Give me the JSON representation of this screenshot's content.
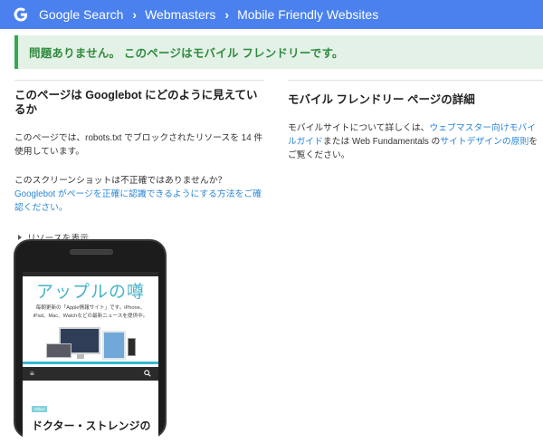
{
  "header": {
    "crumbs": [
      "Google Search",
      "Webmasters",
      "Mobile Friendly Websites"
    ],
    "bg_color": "#4a81ee"
  },
  "banner": {
    "text": "問題ありません。 このページはモバイル フレンドリーです。",
    "color": "#2e8b3d"
  },
  "left": {
    "heading": "このページは Googlebot にどのように見えているか",
    "para1": "このページでは、robots.txt でブロックされたリソースを 14 件使用しています。",
    "para2_text": "このスクリーンショットは不正確ではありませんか？",
    "para2_link": "Googlebot がページを正確に認識できるようにする方法をご確認ください。",
    "toggle_label": "リソースを表示"
  },
  "right": {
    "heading": "モバイル フレンドリー ページの詳細",
    "text_a": "モバイルサイトについて詳しくは、",
    "link_a": "ウェブマスター向けモバイルガイド",
    "text_b": "または Web Fundamentals の",
    "link_b": "サイトデザインの原則",
    "text_c": "をご覧ください。"
  },
  "preview": {
    "site_title": "アップルの噂",
    "site_desc_line1": "毎朝更新の「Apple情報サイト」です。iPhone、",
    "site_desc_line2": "iPad、Mac、Watchなどの最新ニュースを提供中。",
    "tag": "Other",
    "article_title": "ドクター・ストレンジの"
  }
}
